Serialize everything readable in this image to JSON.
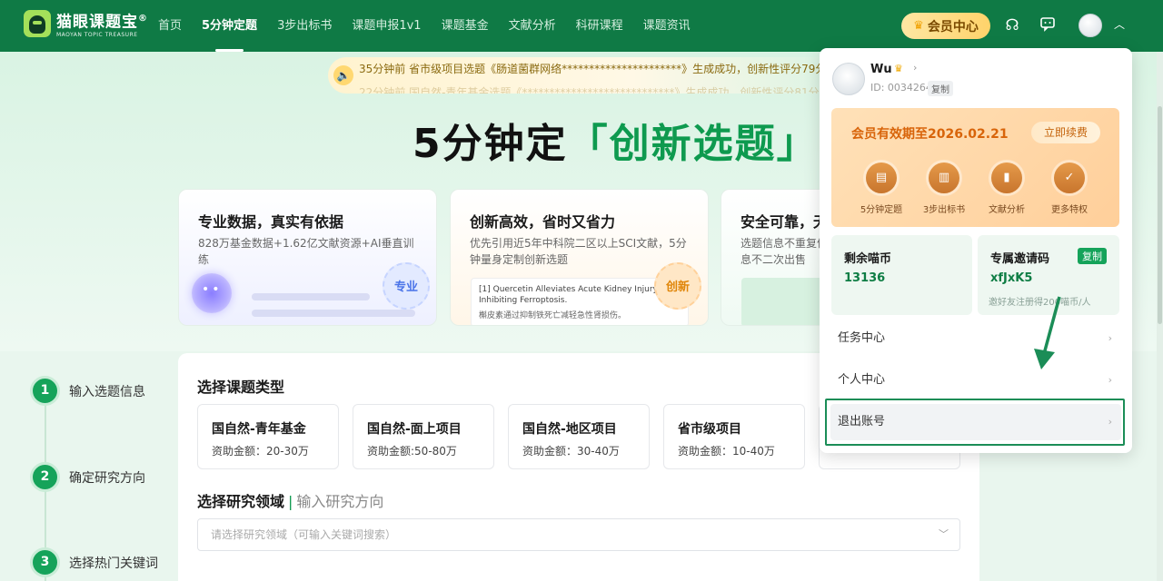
{
  "header": {
    "logo_title": "猫眼课题宝",
    "logo_reg": "®",
    "logo_sub": "MAOYAN TOPIC TREASURE",
    "nav": [
      "首页",
      "5分钟定题",
      "3步出标书",
      "课题申报1v1",
      "课题基金",
      "文献分析",
      "科研课程",
      "课题资讯"
    ],
    "vip_button": "会员中心"
  },
  "notice": {
    "line1": "35分钟前  省市级项目选题《肠道菌群网络**********************》生成成功，创新性评分79分",
    "line2": "22分钟前  国自然-青年基金选题《****************************》生成成功，创新性评分81分"
  },
  "hero": {
    "title_main": "5分钟定",
    "title_highlight": "「创新选题」"
  },
  "features": [
    {
      "title": "专业数据，真实有依据",
      "desc": "828万基金数据+1.62亿文献资源+AI垂直训练",
      "badge": "专业"
    },
    {
      "title": "创新高效，省时又省力",
      "desc": "优先引用近5年中科院二区以上SCI文献，5分钟量身定制创新选题",
      "badge": "创新",
      "paper_en": "[1] Quercetin Alleviates Acute Kidney Injury By Inhibiting Ferroptosis.",
      "paper_cn": "槲皮素通过抑制铁死亡减轻急性肾损伤。"
    },
    {
      "title": "安全可靠，无",
      "desc": "选题信息不重复信息不二次出售"
    }
  ],
  "steps": [
    {
      "num": "1",
      "label": "输入选题信息"
    },
    {
      "num": "2",
      "label": "确定研究方向"
    },
    {
      "num": "3",
      "label": "选择热门关键词"
    }
  ],
  "main": {
    "type_title": "选择课题类型",
    "types": [
      {
        "name": "国自然-青年基金",
        "amount": "资助金额：20-30万"
      },
      {
        "name": "国自然-面上项目",
        "amount": "资助金额:50-80万"
      },
      {
        "name": "国自然-地区项目",
        "amount": "资助金额：30-40万"
      },
      {
        "name": "省市级项目",
        "amount": "资助金额：10-40万"
      }
    ],
    "field_title": "选择研究领域",
    "field_alt": "输入研究方向",
    "field_placeholder": "请选择研究领域（可输入关键词搜索）"
  },
  "dropdown": {
    "user_name": "Wu",
    "user_id": "ID: 0034264",
    "copy": "复制",
    "vip_expire": "会员有效期至2026.02.21",
    "renew": "立即续费",
    "vip_features": [
      "5分钟定题",
      "3步出标书",
      "文献分析",
      "更多特权"
    ],
    "coins_title": "剩余喵币",
    "coins_value": "13136",
    "invite_title": "专属邀请码",
    "invite_copy": "复制",
    "invite_code": "xfJxK5",
    "invite_hint": "邀好友注册得200喵币/人",
    "menu": [
      "任务中心",
      "个人中心",
      "退出账号"
    ]
  }
}
